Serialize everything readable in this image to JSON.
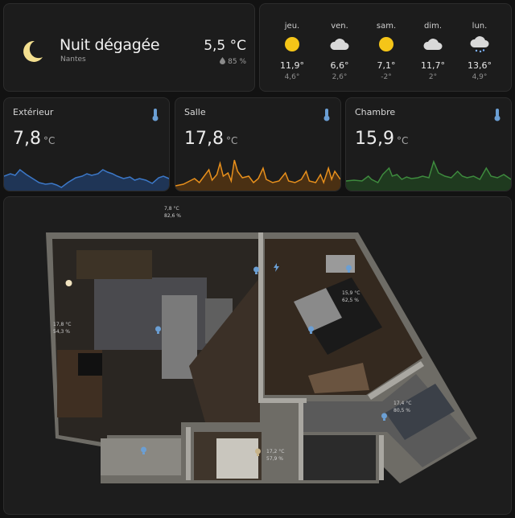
{
  "current": {
    "condition": "Nuit dégagée",
    "location": "Nantes",
    "temperature": "5,5 °C",
    "humidity": "85 %",
    "icon": "moon-icon"
  },
  "forecast": [
    {
      "day": "jeu.",
      "icon": "sun-icon",
      "high": "11,9°",
      "low": "4,6°"
    },
    {
      "day": "ven.",
      "icon": "cloud-icon",
      "high": "6,6°",
      "low": "2,6°"
    },
    {
      "day": "sam.",
      "icon": "sun-icon",
      "high": "7,1°",
      "low": "-2°"
    },
    {
      "day": "dim.",
      "icon": "cloud-icon",
      "high": "11,7°",
      "low": "2°"
    },
    {
      "day": "lun.",
      "icon": "rain-cloud-icon",
      "high": "13,6°",
      "low": "4,9°"
    }
  ],
  "sensors": [
    {
      "name": "Extérieur",
      "value": "7,8",
      "unit": "°C",
      "color": "#3c78c8",
      "icon": "thermometer-icon"
    },
    {
      "name": "Salle",
      "value": "17,8",
      "unit": "°C",
      "color": "#e8901c",
      "icon": "thermometer-icon"
    },
    {
      "name": "Chambre",
      "value": "15,9",
      "unit": "°C",
      "color": "#3e8b3e",
      "icon": "thermometer-icon"
    }
  ],
  "floorplan": {
    "outside": {
      "temp": "7,8 °C",
      "hum": "82,6 %"
    },
    "salon": {
      "temp": "17,8 °C",
      "hum": "54,3 %"
    },
    "chambre": {
      "temp": "15,9 °C",
      "hum": "62,5 %"
    },
    "bathroom": {
      "temp": "17,4 °C",
      "hum": "80,5 %"
    },
    "entree": {
      "temp": "17,2 °C",
      "hum": "57,9 %"
    }
  },
  "colors": {
    "background": "#121212",
    "card": "#1c1c1c",
    "sun": "#f5c518",
    "light_icon": "#6b9fd4"
  }
}
